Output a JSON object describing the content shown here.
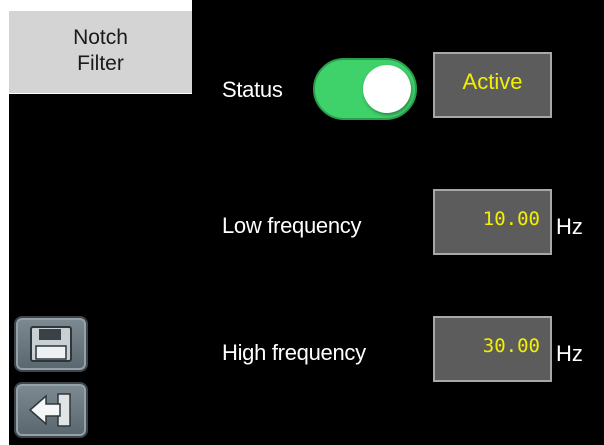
{
  "nav": {
    "tab_line1": "Notch",
    "tab_line2": "Filter"
  },
  "status": {
    "label": "Status",
    "toggle_on": true,
    "value": "Active"
  },
  "low_frequency": {
    "label": "Low frequency",
    "value": "10.00",
    "unit": "Hz"
  },
  "high_frequency": {
    "label": "High frequency",
    "value": "30.00",
    "unit": "Hz"
  },
  "buttons": {
    "save_icon": "floppy-disk-icon",
    "back_icon": "arrow-left-icon"
  },
  "colors": {
    "toggle_on": "#3fd16a",
    "value_text": "#f2f000",
    "value_box": "#5c5c5c"
  }
}
